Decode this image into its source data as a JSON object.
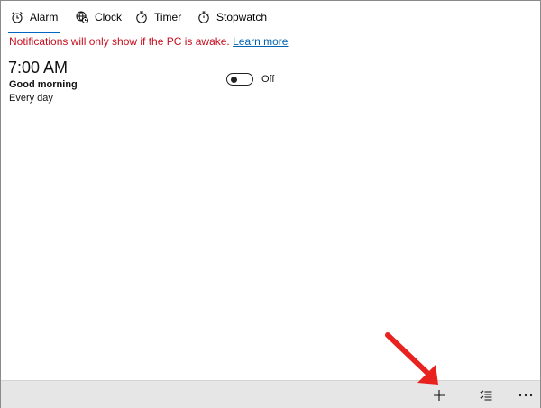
{
  "tabs": [
    {
      "label": "Alarm",
      "icon": "alarm-clock-icon",
      "active": true
    },
    {
      "label": "Clock",
      "icon": "world-clock-icon",
      "active": false
    },
    {
      "label": "Timer",
      "icon": "timer-icon",
      "active": false
    },
    {
      "label": "Stopwatch",
      "icon": "stopwatch-icon",
      "active": false
    }
  ],
  "notice": {
    "text": "Notifications will only show if the PC is awake.",
    "link": "Learn more"
  },
  "alarm": {
    "time": "7:00 AM",
    "name": "Good morning",
    "repeat": "Every day",
    "enabled": false,
    "toggle_label": "Off"
  },
  "bottom_bar": {
    "add_icon": "plus-icon",
    "select_icon": "select-list-icon",
    "more_icon": "more-dots-icon"
  },
  "colors": {
    "accent": "#0067c0",
    "warning_text": "#c50f1f",
    "link": "#0063b1",
    "annotation_arrow": "#e8231f",
    "bottom_bar_bg": "#e6e6e6"
  }
}
